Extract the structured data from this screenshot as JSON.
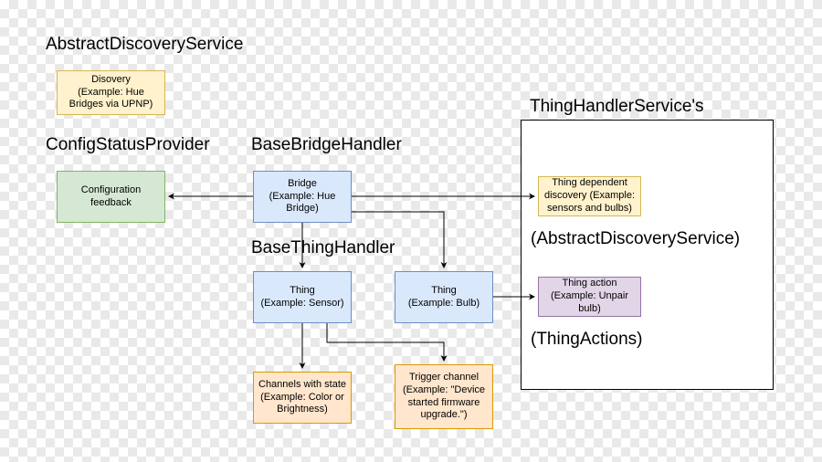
{
  "headings": {
    "abstract_discovery_service": "AbstractDiscoveryService",
    "config_status_provider": "ConfigStatusProvider",
    "base_bridge_handler": "BaseBridgeHandler",
    "base_thing_handler": "BaseThingHandler",
    "thing_handler_services": "ThingHandlerService's",
    "abstract_discovery_service_paren": "(AbstractDiscoveryService)",
    "thing_actions_paren": "(ThingActions)"
  },
  "boxes": {
    "discovery": "Disovery\n(Example: Hue Bridges via UPNP)",
    "config_feedback": "Configuration feedback",
    "bridge": "Bridge\n(Example: Hue Bridge)",
    "thing_sensor": "Thing\n(Example: Sensor)",
    "thing_bulb": "Thing\n(Example: Bulb)",
    "channels_state": "Channels with state (Example: Color or Brightness)",
    "trigger_channel": "Trigger channel (Example: \"Device started firmware upgrade.\")",
    "thing_dep_discovery": "Thing dependent discovery (Example: sensors and bulbs)",
    "thing_action": "Thing action (Example: Unpair bulb)"
  },
  "chart_data": {
    "type": "diagram",
    "nodes": [
      {
        "id": "discovery",
        "group": "AbstractDiscoveryService",
        "label": "Disovery (Example: Hue Bridges via UPNP)",
        "fill": "#fff2cc"
      },
      {
        "id": "config_feedback",
        "group": "ConfigStatusProvider",
        "label": "Configuration feedback",
        "fill": "#d5e8d4"
      },
      {
        "id": "bridge",
        "group": "BaseBridgeHandler",
        "label": "Bridge (Example: Hue Bridge)",
        "fill": "#dae8fc"
      },
      {
        "id": "thing_sensor",
        "group": "BaseThingHandler",
        "label": "Thing (Example: Sensor)",
        "fill": "#dae8fc"
      },
      {
        "id": "thing_bulb",
        "group": "BaseThingHandler",
        "label": "Thing (Example: Bulb)",
        "fill": "#dae8fc"
      },
      {
        "id": "channels_state",
        "group": null,
        "label": "Channels with state (Example: Color or Brightness)",
        "fill": "#ffe6cc"
      },
      {
        "id": "trigger_channel",
        "group": null,
        "label": "Trigger channel (Example: \"Device started firmware upgrade.\")",
        "fill": "#ffe6cc"
      },
      {
        "id": "thing_dep_discovery",
        "group": "ThingHandlerService's",
        "sublabel": "(AbstractDiscoveryService)",
        "label": "Thing dependent discovery (Example: sensors and bulbs)",
        "fill": "#fff2cc"
      },
      {
        "id": "thing_action",
        "group": "ThingHandlerService's",
        "sublabel": "(ThingActions)",
        "label": "Thing action (Example: Unpair bulb)",
        "fill": "#e1d5e7"
      }
    ],
    "edges": [
      {
        "from": "bridge",
        "to": "config_feedback"
      },
      {
        "from": "bridge",
        "to": "thing_dep_discovery"
      },
      {
        "from": "bridge",
        "to": "thing_sensor"
      },
      {
        "from": "bridge",
        "to": "thing_bulb"
      },
      {
        "from": "thing_sensor",
        "to": "channels_state"
      },
      {
        "from": "thing_sensor",
        "to": "trigger_channel"
      },
      {
        "from": "thing_bulb",
        "to": "thing_action"
      }
    ]
  }
}
